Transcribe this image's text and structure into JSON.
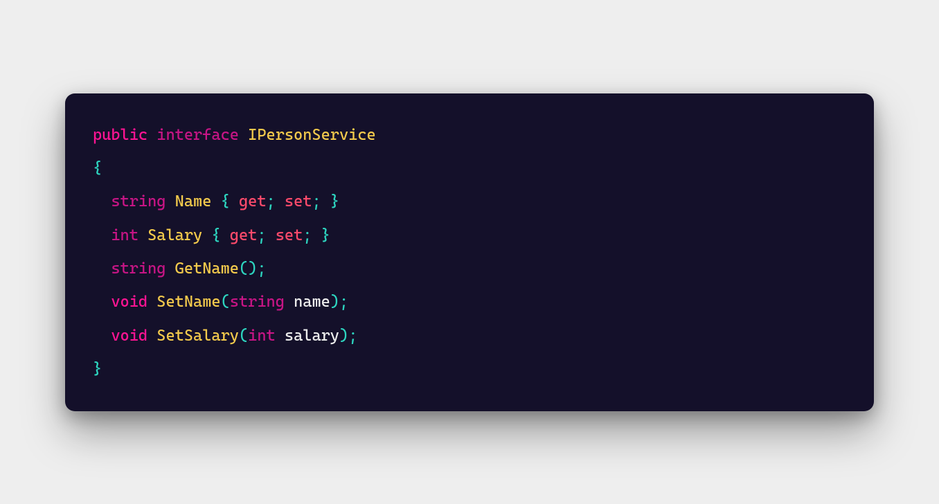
{
  "code": {
    "l1": {
      "public": "public",
      "interface": "interface",
      "name": "IPersonService"
    },
    "l2": {
      "brace": "{"
    },
    "l3": {
      "type": "string",
      "name": "Name",
      "ob": "{",
      "get": "get",
      "sc1": ";",
      "set": "set",
      "sc2": ";",
      "cb": "}"
    },
    "l4": {
      "type": "int",
      "name": "Salary",
      "ob": "{",
      "get": "get",
      "sc1": ";",
      "set": "set",
      "sc2": ";",
      "cb": "}"
    },
    "l5": {
      "type": "string",
      "name": "GetName",
      "op": "(",
      "cp": ")",
      "sc": ";"
    },
    "l6": {
      "void": "void",
      "name": "SetName",
      "op": "(",
      "ptype": "string",
      "pname": "name",
      "cp": ")",
      "sc": ";"
    },
    "l7": {
      "void": "void",
      "name": "SetSalary",
      "op": "(",
      "ptype": "int",
      "pname": "salary",
      "cp": ")",
      "sc": ";"
    },
    "l8": {
      "brace": "}"
    }
  }
}
